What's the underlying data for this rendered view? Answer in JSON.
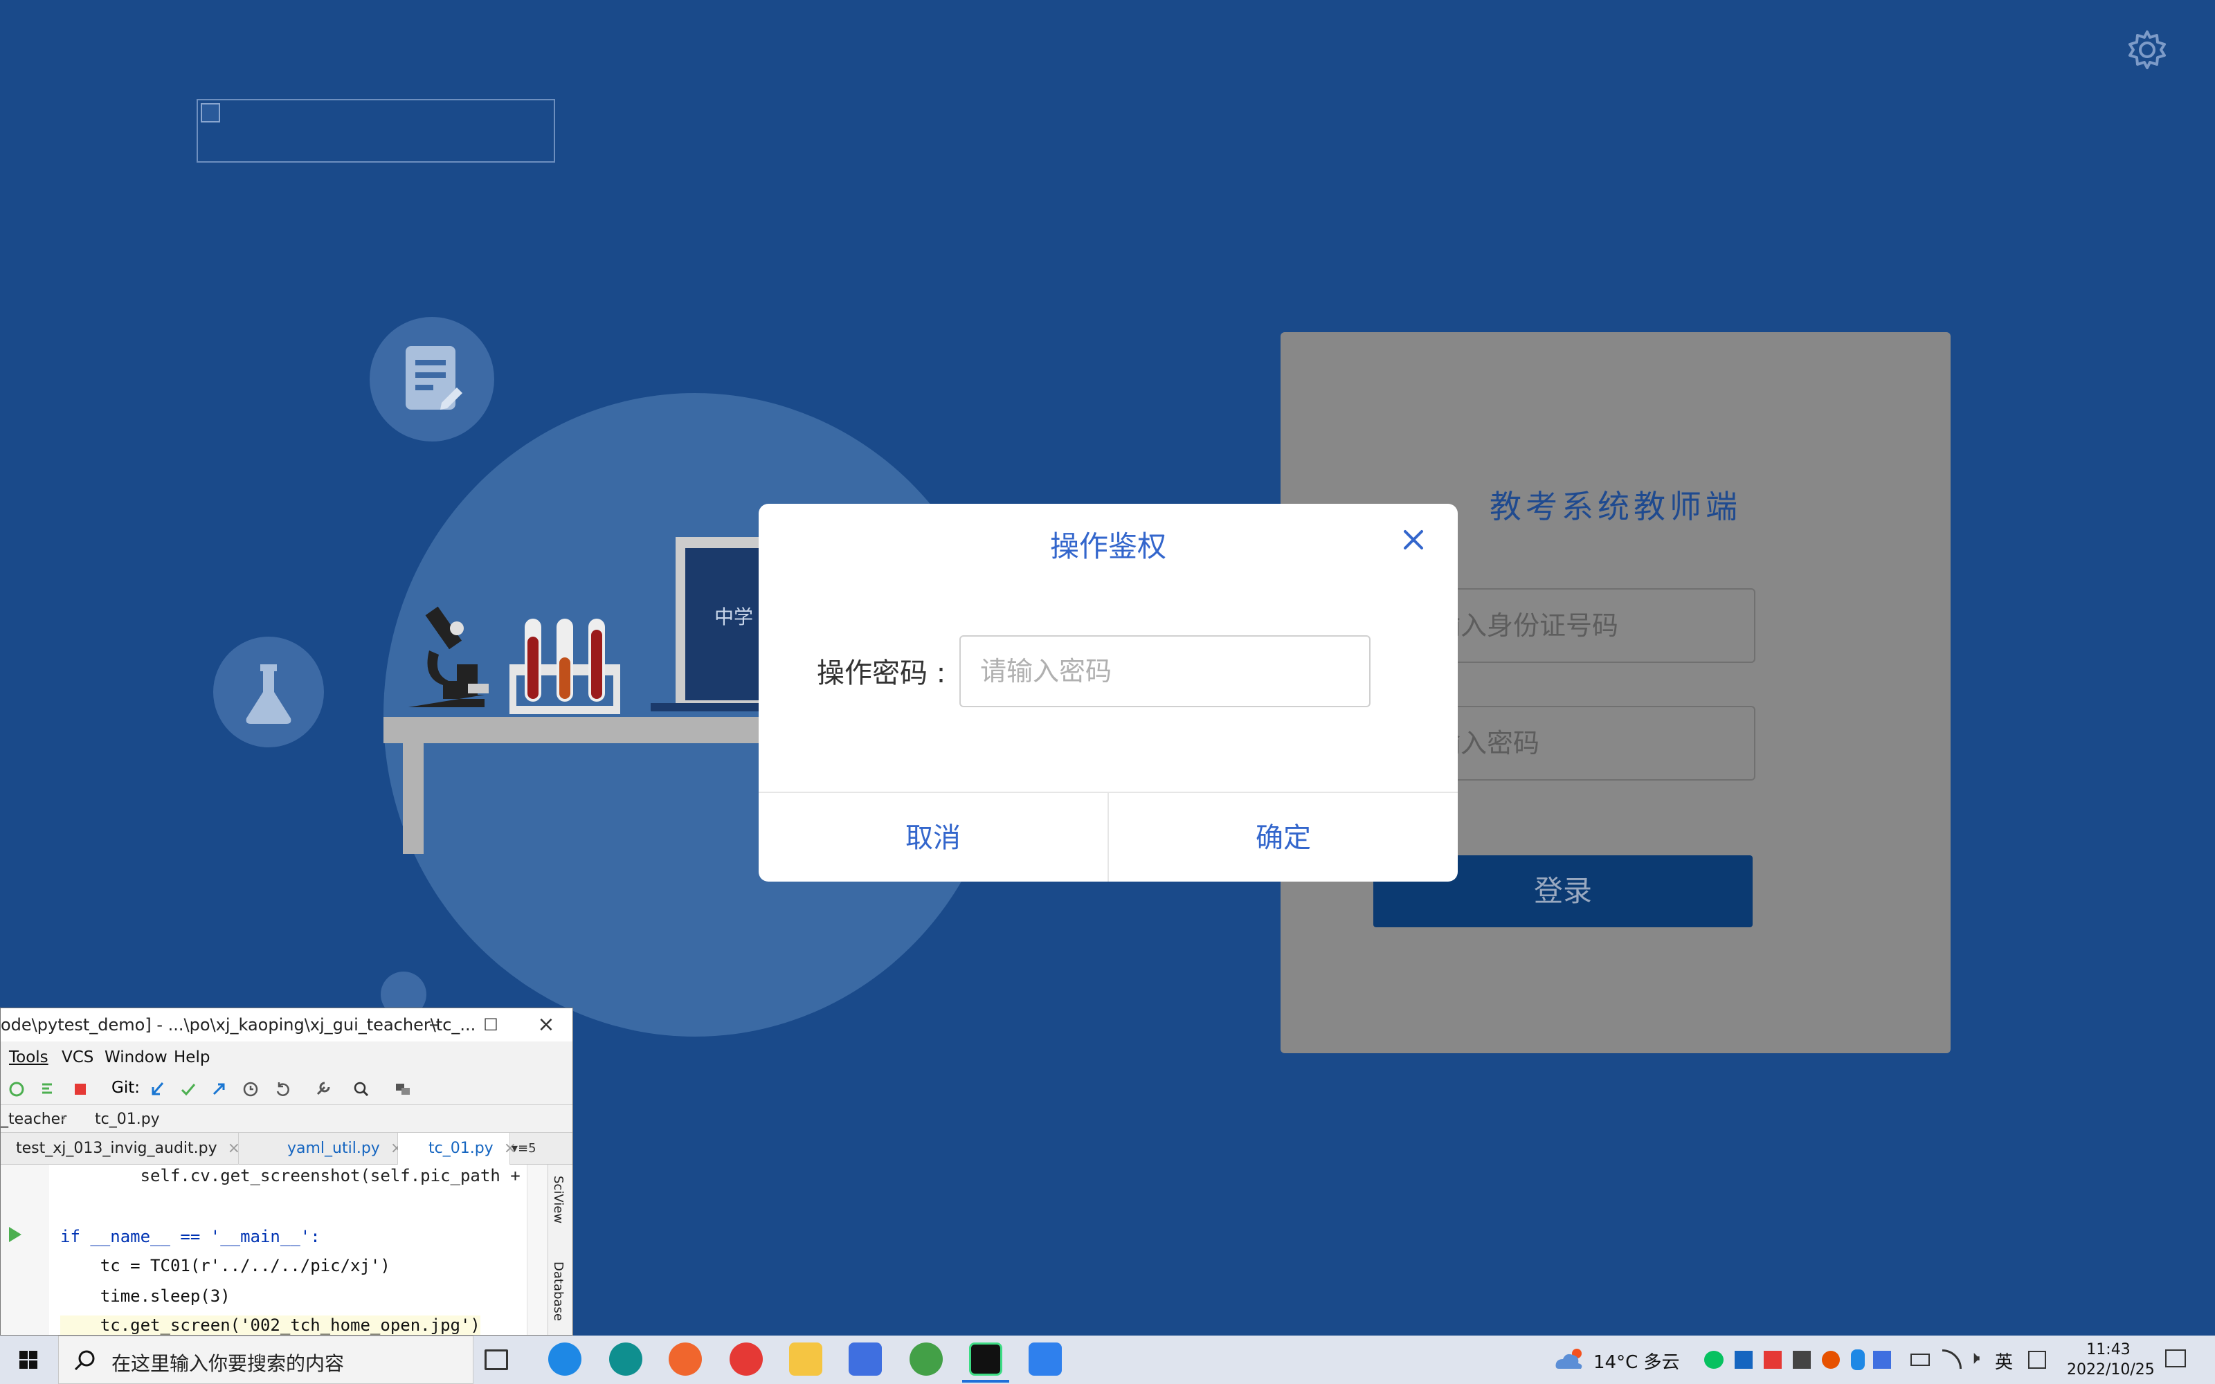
{
  "login": {
    "heading": "教考系统教师端",
    "id_placeholder": "请输入身份证号码",
    "password_placeholder": "请输入密码",
    "login_button": "登录"
  },
  "background": {
    "laptop_text": "中学"
  },
  "modal": {
    "title": "操作鉴权",
    "password_label": "操作密码 :",
    "password_placeholder": "请输入密码",
    "cancel": "取消",
    "confirm": "确定"
  },
  "ide": {
    "title": "ode\\pytest_demo] - ...\\po\\xj_kaoping\\xj_gui_teacher\\tc_...",
    "menu": [
      "Tools",
      "VCS",
      "Window",
      "Help"
    ],
    "git_label": "Git:",
    "breadcrumb": [
      "_teacher",
      "tc_01.py"
    ],
    "tabs": [
      "test_xj_013_invig_audit.py",
      "yaml_util.py",
      "tc_01.py"
    ],
    "tab_overflow": "5",
    "side_panels": [
      "SciView",
      "Database"
    ],
    "code": [
      "        self.cv.get_screenshot(self.pic_path + pi",
      "",
      "if __name__ == '__main__':",
      "    tc = TC01(r'../../../pic/xj')",
      "    time.sleep(3)",
      "    tc.get_screen('002_tch_home_open.jpg')"
    ]
  },
  "taskbar": {
    "search_placeholder": "在这里输入你要搜索的内容",
    "weather": "14°C 多云",
    "ime": "英",
    "time": "11:43",
    "date": "2022/10/25"
  }
}
